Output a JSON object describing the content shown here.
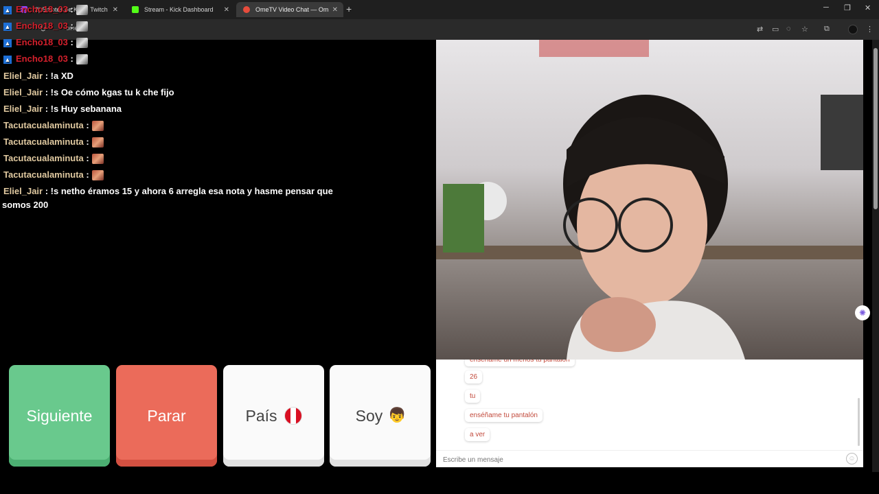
{
  "browser": {
    "tabs": [
      {
        "title": "(2) Emotes de Kick | Twitch Live...",
        "color": "#9146ff"
      },
      {
        "title": "Stream - Kick Dashboard",
        "color": "#53fc18"
      },
      {
        "title": "OmeTV Video Chat — Ome",
        "color": "#e74c3c"
      }
    ],
    "new_tab": "+",
    "url": "ome.tv",
    "controls": {
      "minimize": "─",
      "restore": "❐",
      "close": "✕"
    }
  },
  "stream_chat": [
    {
      "user": "Encho18_03",
      "text": ":",
      "emote": true,
      "red": true
    },
    {
      "user": "Encho18_03",
      "text": ":",
      "emote": true,
      "red": true
    },
    {
      "user": "Encho18_03",
      "text": ":",
      "emote": true,
      "red": true
    },
    {
      "user": "Encho18_03",
      "text": ":",
      "emote": true,
      "red": true
    },
    {
      "user": "Eliel_Jair",
      "text": ": !a XD",
      "emote": false
    },
    {
      "user": "Eliel_Jair",
      "text": ": !s Oe cómo kgas tu k che fijo",
      "emote": false
    },
    {
      "user": "Eliel_Jair",
      "text": ": !s Huy sebanana",
      "emote": false
    },
    {
      "user": "Tacutacualaminuta",
      "text": ":",
      "emote": true
    },
    {
      "user": "Tacutacualaminuta",
      "text": ":",
      "emote": true
    },
    {
      "user": "Tacutacualaminuta",
      "text": ":",
      "emote": true
    },
    {
      "user": "Tacutacualaminuta",
      "text": ":",
      "emote": true
    },
    {
      "user": "Eliel_Jair",
      "text": ": !s netho éramos 15 y ahora 6 arregla esa nota y hasme pensar que",
      "emote": false
    }
  ],
  "stream_chat_wrap": "somos 200",
  "buttons": {
    "next": "Siguiente",
    "stop": "Parar",
    "country": "País",
    "me": "Soy"
  },
  "messages": [
    "enséñame un menos tu pantalón",
    "26",
    "tu",
    "enséñame tu pantalón",
    "a ver"
  ],
  "input": {
    "placeholder": "Escribe un mensaje"
  }
}
